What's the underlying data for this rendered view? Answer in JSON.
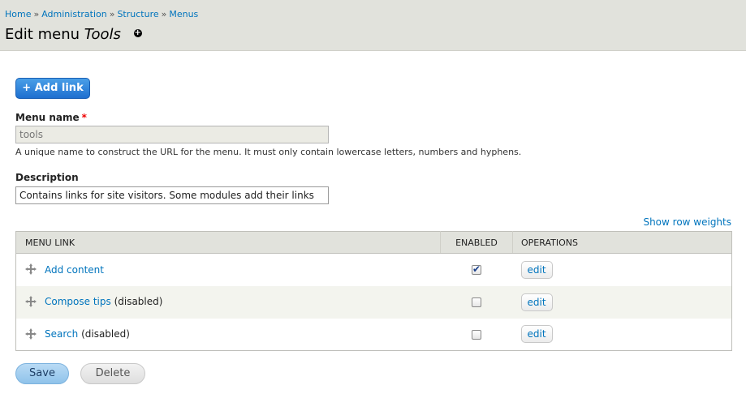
{
  "breadcrumb": {
    "items": [
      "Home",
      "Administration",
      "Structure",
      "Menus"
    ],
    "separator": "»"
  },
  "page": {
    "title_prefix": "Edit menu",
    "title_menu": "Tools",
    "shortcut_icon": "plus-circle-icon"
  },
  "actions": {
    "add_link_label": "+ Add link"
  },
  "form": {
    "menu_name": {
      "label": "Menu name",
      "required_marker": "*",
      "value": "tools",
      "help": "A unique name to construct the URL for the menu. It must only contain lowercase letters, numbers and hyphens."
    },
    "description": {
      "label": "Description",
      "value": "Contains links for site visitors. Some modules add their links"
    }
  },
  "table": {
    "show_weights_label": "Show row weights",
    "headers": {
      "menu_link": "MENU LINK",
      "enabled": "ENABLED",
      "operations": "OPERATIONS"
    },
    "rows": [
      {
        "link": "Add content",
        "status": "",
        "enabled": true,
        "op": "edit"
      },
      {
        "link": "Compose tips",
        "status": "(disabled)",
        "enabled": false,
        "op": "edit"
      },
      {
        "link": "Search",
        "status": "(disabled)",
        "enabled": false,
        "op": "edit"
      }
    ]
  },
  "buttons": {
    "save": "Save",
    "delete": "Delete"
  },
  "colors": {
    "header_bg": "#e1e2dc",
    "link": "#0074bd",
    "primary_button": "#1e6fd0",
    "save_button": "#8fc3ea",
    "required": "#ee0000"
  }
}
